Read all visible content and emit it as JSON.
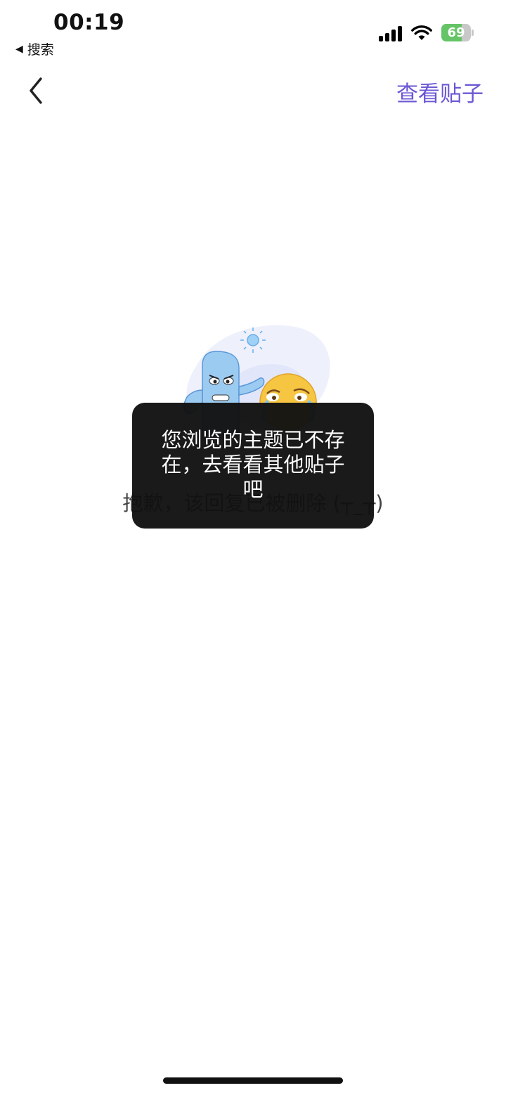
{
  "status_bar": {
    "time": "00:19",
    "back_app_label": "搜索",
    "battery_level": 69,
    "battery_text": "69",
    "battery_color": "#65c466"
  },
  "nav": {
    "back_icon": "chevron-left-icon",
    "view_post_label": "查看贴子",
    "accent_color": "#6b57d4"
  },
  "empty_state": {
    "illustration": "cactus-and-crying-emoji-illustration",
    "message": "抱歉，该回复已被删除 (┬_┬)"
  },
  "toast": {
    "message": "您浏览的主题已不存在，去看看其他贴子吧"
  }
}
